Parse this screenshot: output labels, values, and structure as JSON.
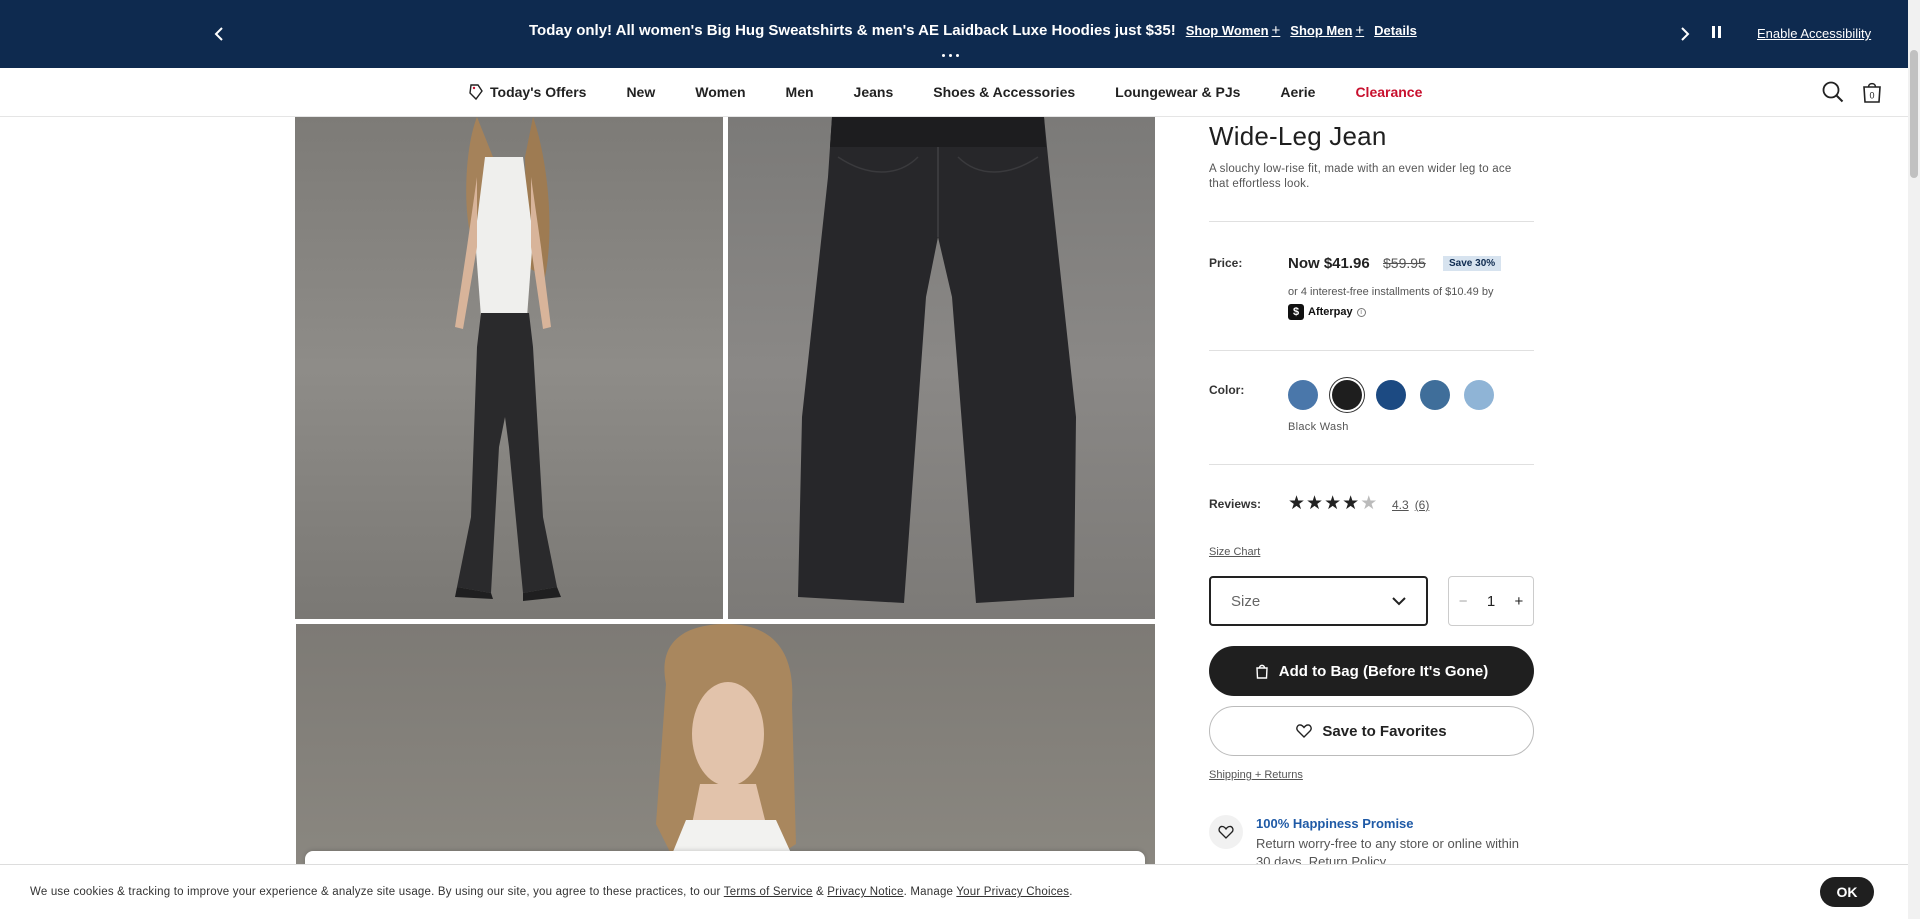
{
  "promo": {
    "message": "Today only! All women's Big Hug Sweatshirts & men's AE Laidback Luxe Hoodies just $35!",
    "shop_women": "Shop Women",
    "shop_men": "Shop Men",
    "details": "Details",
    "plus": "+",
    "enable_accessibility": "Enable Accessibility"
  },
  "nav": {
    "items": [
      {
        "label": "Today's Offers",
        "icon": "tag-icon"
      },
      {
        "label": "New"
      },
      {
        "label": "Women"
      },
      {
        "label": "Men"
      },
      {
        "label": "Jeans"
      },
      {
        "label": "Shoes & Accessories"
      },
      {
        "label": "Loungewear & PJs"
      },
      {
        "label": "Aerie"
      },
      {
        "label": "Clearance",
        "color": "#c8102e"
      }
    ],
    "bag_count": "0"
  },
  "product": {
    "title": "Wide-Leg Jean",
    "description": "A slouchy low-rise fit, made with an even wider leg to ace that effortless look.",
    "price_label": "Price:",
    "price_now": "Now $41.96",
    "price_old": "$59.95",
    "save_badge": "Save 30%",
    "installments": "or 4 interest-free installments of $10.49 by",
    "afterpay": "Afterpay",
    "color_label": "Color:",
    "swatches": [
      "#4a77aa",
      "#1e1e1e",
      "#1c4a82",
      "#3f6e9a",
      "#8fb4d6"
    ],
    "selected_color": "Black Wash",
    "reviews_label": "Reviews:",
    "rating": "4.3",
    "review_count": "(6)",
    "size_chart": "Size Chart",
    "size_placeholder": "Size",
    "quantity": "1",
    "add_to_bag": "Add to Bag (Before It's Gone)",
    "save_favorites": "Save to Favorites",
    "shipping_returns": "Shipping + Returns",
    "happiness_title": "100% Happiness Promise",
    "happiness_text": "Return worry-free to any store or online within 30 days. Return Policy"
  },
  "cookie": {
    "text_pre": "We use cookies & tracking to improve your experience & analyze site usage. By using our site, you agree to these practices, to our ",
    "terms": "Terms of Service",
    "amp": " & ",
    "privacy": "Privacy Notice",
    "manage": ". Manage ",
    "choices": "Your Privacy Choices",
    "period": ".",
    "ok": "OK"
  }
}
